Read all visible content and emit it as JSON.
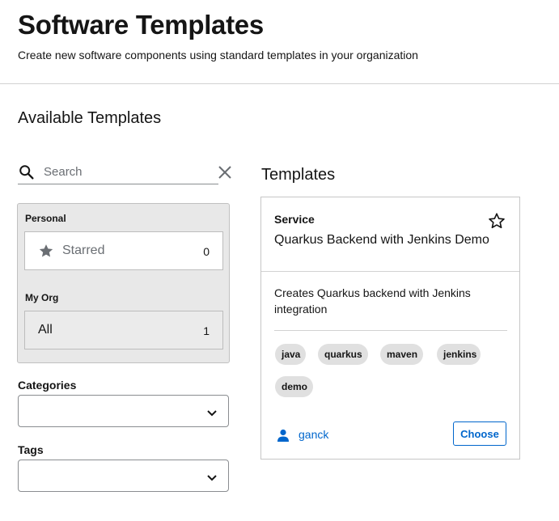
{
  "header": {
    "title": "Software Templates",
    "subtitle": "Create new software components using standard templates in your organization"
  },
  "sidebar": {
    "section_title": "Available Templates",
    "search": {
      "placeholder": "Search",
      "value": ""
    },
    "groups": [
      {
        "label": "Personal",
        "items": [
          {
            "label": "Starred",
            "count": "0",
            "icon": "star-icon"
          }
        ]
      },
      {
        "label": "My Org",
        "items": [
          {
            "label": "All",
            "count": "1",
            "selected": true
          }
        ]
      }
    ],
    "categories": {
      "label": "Categories",
      "value": ""
    },
    "tags": {
      "label": "Tags",
      "value": ""
    }
  },
  "main": {
    "title": "Templates",
    "cards": [
      {
        "type": "Service",
        "title": "Quarkus Backend with Jenkins Demo",
        "description": "Creates Quarkus backend with Jenkins integration",
        "tags": [
          "java",
          "quarkus",
          "maven",
          "jenkins",
          "demo"
        ],
        "owner": "ganck",
        "action_label": "Choose"
      }
    ]
  },
  "colors": {
    "link": "#0066cc",
    "text": "#151515",
    "chip_bg": "#e0e0e0",
    "panel_bg": "#e8e8e8"
  }
}
